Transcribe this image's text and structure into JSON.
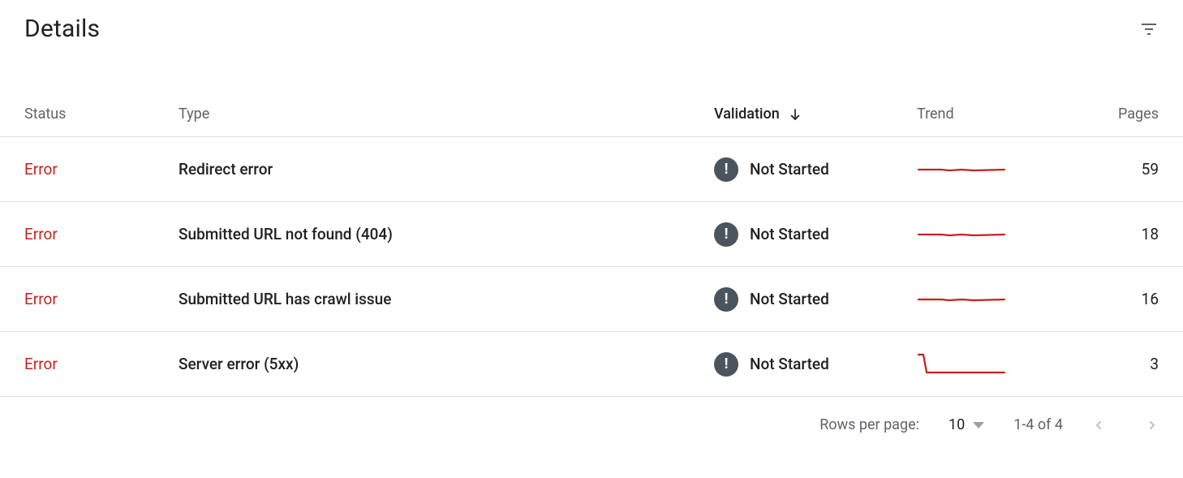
{
  "header": {
    "title": "Details"
  },
  "columns": {
    "status": "Status",
    "type": "Type",
    "validation": "Validation",
    "trend": "Trend",
    "pages": "Pages"
  },
  "rows": [
    {
      "status": "Error",
      "type": "Redirect error",
      "validation": "Not Started",
      "pages": "59",
      "trend": "flat"
    },
    {
      "status": "Error",
      "type": "Submitted URL not found (404)",
      "validation": "Not Started",
      "pages": "18",
      "trend": "flat"
    },
    {
      "status": "Error",
      "type": "Submitted URL has crawl issue",
      "validation": "Not Started",
      "pages": "16",
      "trend": "flat"
    },
    {
      "status": "Error",
      "type": "Server error (5xx)",
      "validation": "Not Started",
      "pages": "3",
      "trend": "drop"
    }
  ],
  "footer": {
    "rows_per_page_label": "Rows per page:",
    "rows_per_page_value": "10",
    "range": "1-4 of 4"
  },
  "colors": {
    "error": "#c5221f",
    "trend_line": "#c5221f",
    "badge_bg": "#4a545c"
  }
}
